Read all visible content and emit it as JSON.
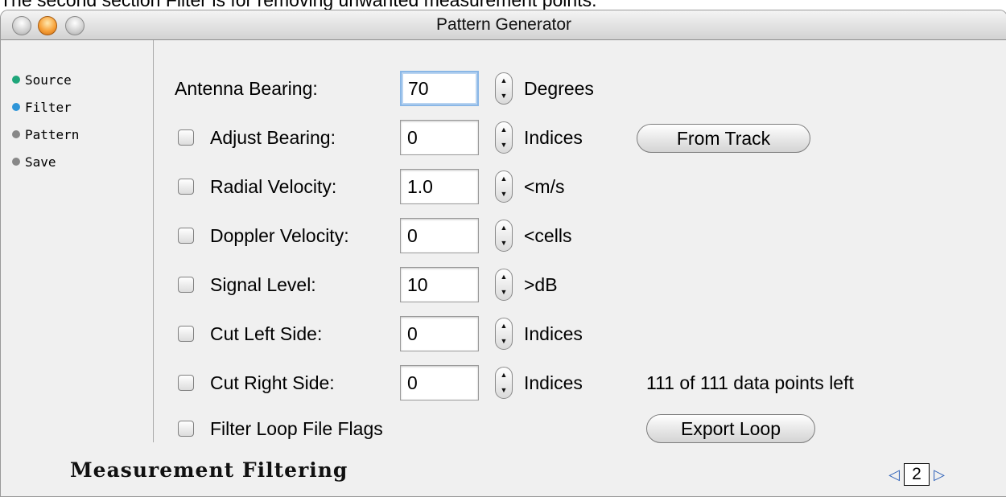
{
  "caption": "The second section Filter is for removing unwanted measurement points.",
  "window": {
    "title": "Pattern Generator"
  },
  "sidebar": {
    "steps": [
      {
        "label": "Source",
        "color": "#1fa67a"
      },
      {
        "label": "Filter",
        "color": "#2e95d8"
      },
      {
        "label": "Pattern",
        "color": "#888888"
      },
      {
        "label": "Save",
        "color": "#888888"
      }
    ]
  },
  "form": {
    "antenna_bearing": {
      "label": "Antenna Bearing:",
      "value": "70",
      "unit": "Degrees"
    },
    "adjust_bearing": {
      "label": "Adjust Bearing:",
      "value": "0",
      "unit": "Indices",
      "checked": false
    },
    "radial_velocity": {
      "label": "Radial Velocity:",
      "value": "1.0",
      "unit": "<m/s",
      "checked": false
    },
    "doppler_velocity": {
      "label": "Doppler Velocity:",
      "value": "0",
      "unit": "<cells",
      "checked": false
    },
    "signal_level": {
      "label": "Signal Level:",
      "value": "10",
      "unit": ">dB",
      "checked": false
    },
    "cut_left": {
      "label": "Cut Left Side:",
      "value": "0",
      "unit": "Indices",
      "checked": false
    },
    "cut_right": {
      "label": "Cut Right Side:",
      "value": "0",
      "unit": "Indices",
      "checked": false
    },
    "filter_loop": {
      "label": "Filter Loop File Flags",
      "checked": false
    }
  },
  "buttons": {
    "from_track": "From Track",
    "export_loop": "Export Loop"
  },
  "status": {
    "points_left": "111 of 111 data points left"
  },
  "footer": {
    "title": "Measurement Filtering",
    "page": "2"
  },
  "colors": {
    "focus_ring": "#8ab7e6",
    "pager_arrow": "#2b5fb8"
  }
}
